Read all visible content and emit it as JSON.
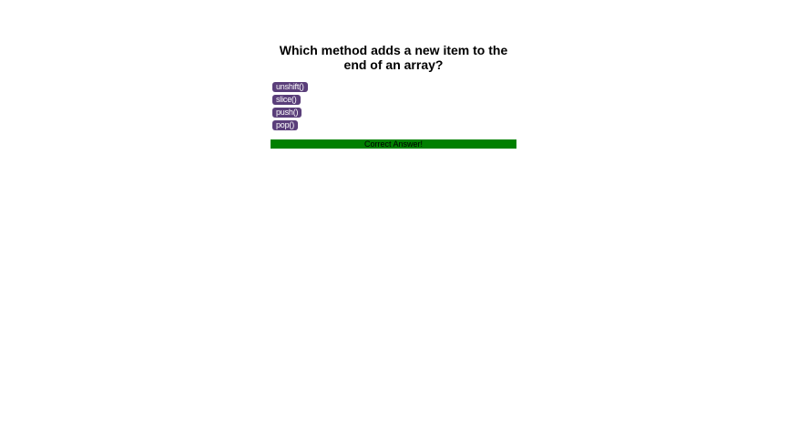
{
  "question": "Which method adds a new item to the end of an array?",
  "answers": [
    "unshift()",
    "slice()",
    "push()",
    "pop()"
  ],
  "result": {
    "text": "Correct Answer!",
    "color": "#008000"
  },
  "colors": {
    "answer_button": "#5a3e7a"
  }
}
